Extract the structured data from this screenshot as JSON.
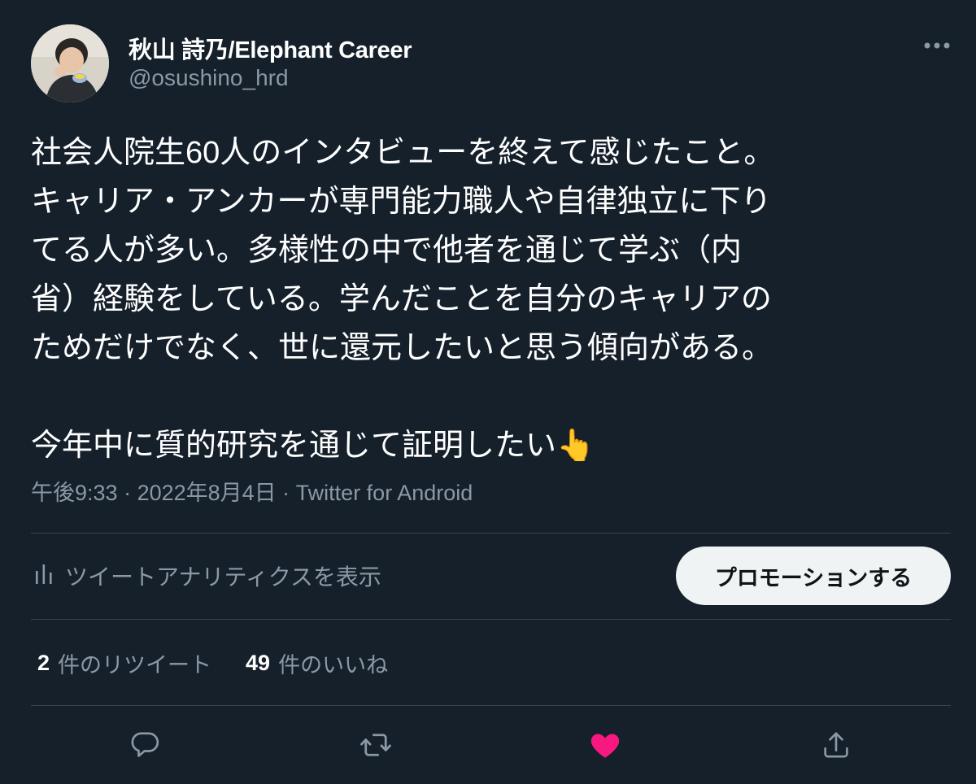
{
  "author": {
    "display_name": "秋山 詩乃/Elephant Career",
    "handle": "@osushino_hrd"
  },
  "tweet": {
    "lines": [
      "社会人院生60人のインタビューを終えて感じたこと。",
      "キャリア・アンカーが専門能力職人や自律独立に下り",
      "てる人が多い。多様性の中で他者を通じて学ぶ（内",
      "省）経験をしている。学んだことを自分のキャリアの",
      "ためだけでなく、世に還元したいと思う傾向がある。",
      "今年中に質的研究を通じて証明したい👆"
    ]
  },
  "meta": {
    "time": "午後9:33",
    "separator": " · ",
    "date": "2022年8月4日",
    "source": "Twitter for Android"
  },
  "analytics": {
    "label": "ツイートアナリティクスを表示",
    "icon": "bar-chart-icon"
  },
  "promote": {
    "label": "プロモーションする"
  },
  "stats": {
    "retweets": {
      "count": "2",
      "label": "件のリツイート"
    },
    "likes": {
      "count": "49",
      "label": "件のいいね"
    }
  },
  "actions": {
    "reply_icon": "reply-icon",
    "retweet_icon": "retweet-icon",
    "like_icon": "heart-icon",
    "share_icon": "share-icon"
  },
  "colors": {
    "background": "#15202b",
    "text": "#ffffff",
    "secondary": "#8b98a5",
    "divider": "#38444d",
    "like": "#f91880",
    "promote_bg": "#eff3f4"
  }
}
